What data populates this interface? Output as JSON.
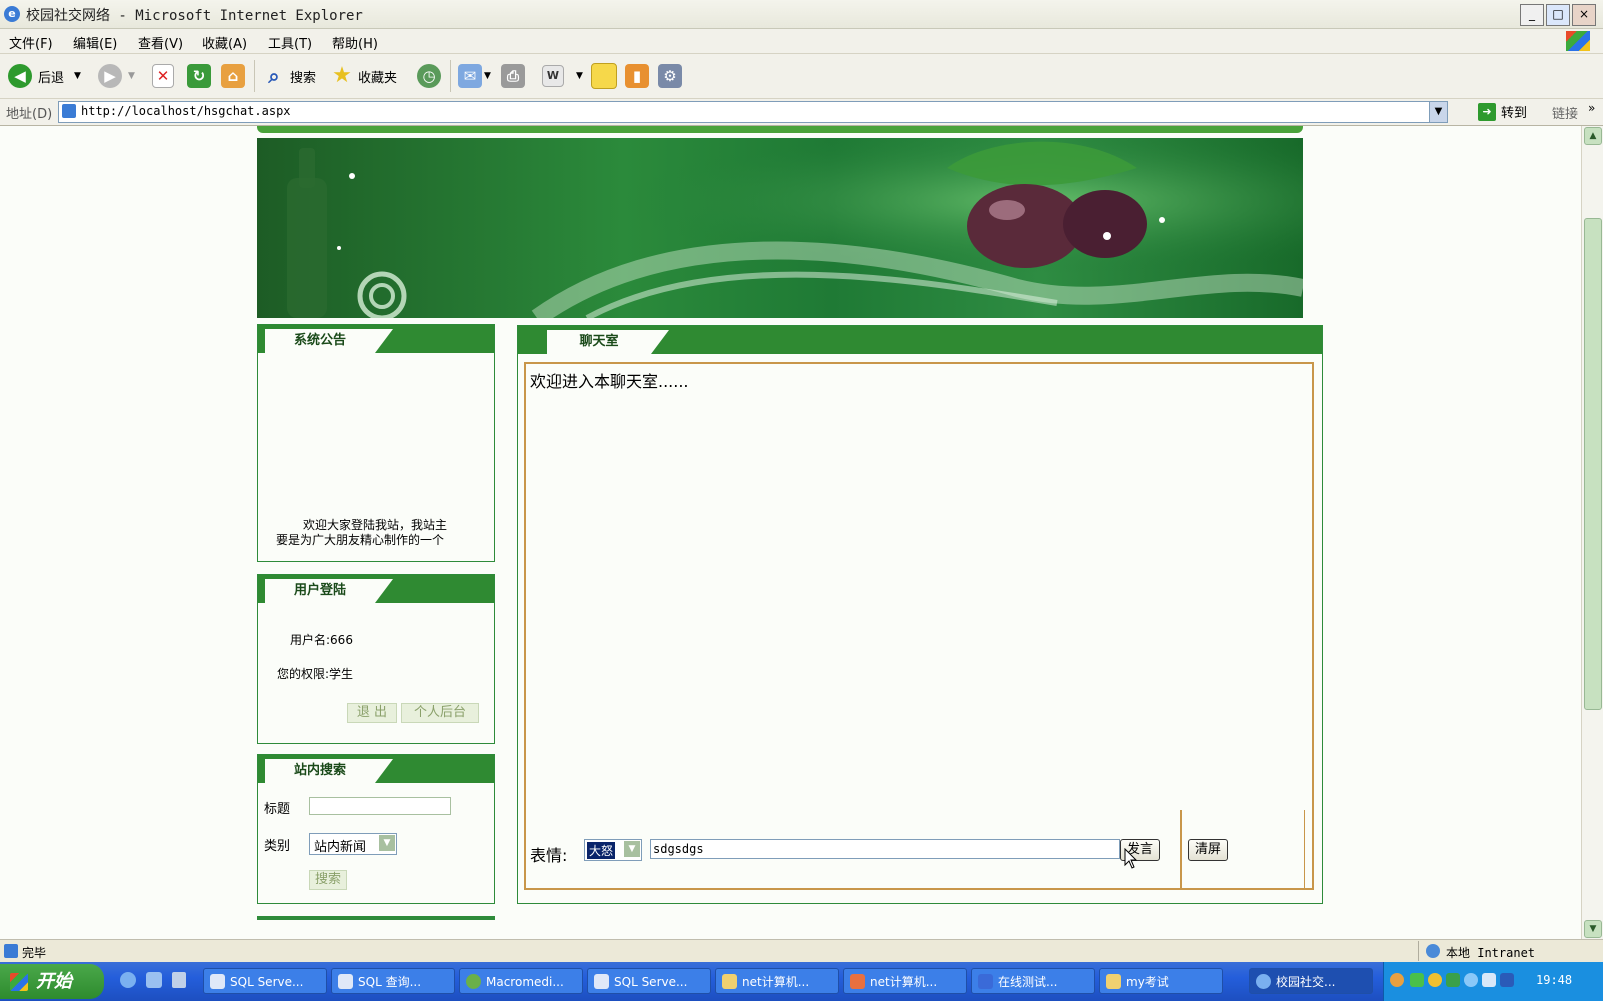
{
  "window": {
    "title": "校园社交网络 - Microsoft Internet Explorer",
    "controls": [
      "_",
      "□",
      "×"
    ]
  },
  "menu": [
    "文件(F)",
    "编辑(E)",
    "查看(V)",
    "收藏(A)",
    "工具(T)",
    "帮助(H)"
  ],
  "toolbar": {
    "back": "后退",
    "search": "搜索",
    "favorites": "收藏夹"
  },
  "address": {
    "label": "地址(D)",
    "url": "http://localhost/hsgchat.aspx",
    "go": "转到",
    "links": "链接"
  },
  "page": {
    "announcement": {
      "title": "系统公告",
      "text_line1": "欢迎大家登陆我站，我站主",
      "text_line2": "要是为广大朋友精心制作的一个"
    },
    "login": {
      "title": "用户登陆",
      "username": "用户名:666",
      "role": "您的权限:学生",
      "logout": "退 出",
      "backend": "个人后台"
    },
    "search": {
      "title": "站内搜索",
      "title_label": "标题",
      "title_value": "",
      "category_label": "类别",
      "category_value": "站内新闻",
      "submit": "搜索"
    },
    "chat": {
      "title": "聊天室",
      "welcome": "欢迎进入本聊天室......",
      "emotion_label": "表情:",
      "emotion_value": "大怒",
      "message_value": "sdgsdgs",
      "send": "发言",
      "clear": "清屏"
    }
  },
  "status": {
    "left": "完毕",
    "zone": "本地 Intranet"
  },
  "taskbar": {
    "start": "开始",
    "tasks": [
      "SQL Serve...",
      "SQL 查询...",
      "Macromedi...",
      "SQL Serve...",
      "net计算机...",
      "net计算机...",
      "在线测试...",
      "my考试",
      "校园社交..."
    ],
    "clock": "19:48"
  },
  "colors": {
    "panel_green": "#2f8a32",
    "chat_border": "#c8964a",
    "xp_blue": "#245edb"
  }
}
